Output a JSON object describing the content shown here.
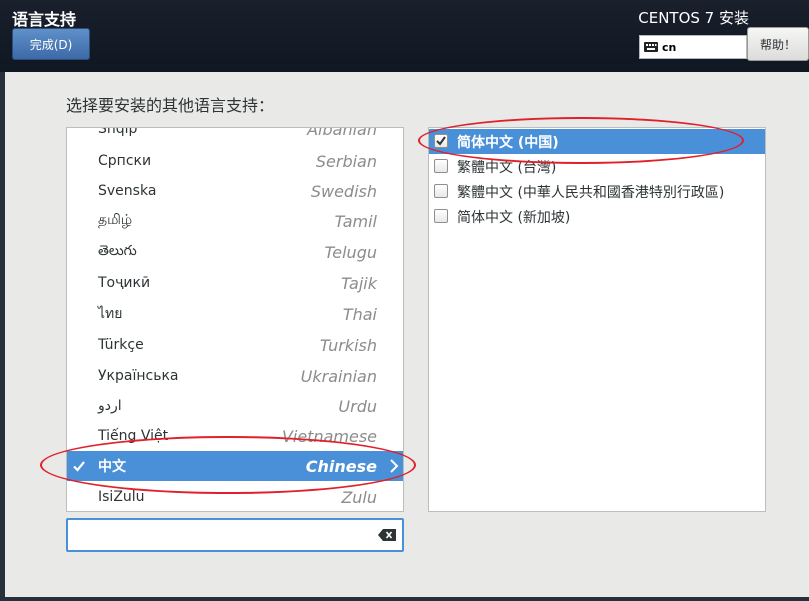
{
  "header": {
    "screen_title": "语言支持",
    "done_label": "完成(D)",
    "product_title": "CENTOS 7 安装",
    "keyboard_layout": "cn",
    "help_label": "帮助！"
  },
  "prompt": "选择要安装的其他语言支持：",
  "languages": [
    {
      "native": "Shqip",
      "english": "Albanian"
    },
    {
      "native": "Српски",
      "english": "Serbian"
    },
    {
      "native": "Svenska",
      "english": "Swedish"
    },
    {
      "native": "தமிழ்",
      "english": "Tamil"
    },
    {
      "native": "తెలుగు",
      "english": "Telugu"
    },
    {
      "native": "Тоҷикӣ",
      "english": "Tajik"
    },
    {
      "native": "ไทย",
      "english": "Thai"
    },
    {
      "native": "Türkçe",
      "english": "Turkish"
    },
    {
      "native": "Українська",
      "english": "Ukrainian"
    },
    {
      "native": "اردو",
      "english": "Urdu"
    },
    {
      "native": "Tiếng Việt",
      "english": "Vietnamese"
    },
    {
      "native": "中文",
      "english": "Chinese",
      "selected": true
    },
    {
      "native": "IsiZulu",
      "english": "Zulu"
    }
  ],
  "search": {
    "value": ""
  },
  "locales": [
    {
      "label": "简体中文 (中国)",
      "checked": true,
      "selected": true
    },
    {
      "label": "繁體中文 (台灣)",
      "checked": false
    },
    {
      "label": "繁體中文 (中華人民共和國香港特別行政區)",
      "checked": false
    },
    {
      "label": "简体中文 (新加坡)",
      "checked": false
    }
  ],
  "colors": {
    "selection": "#4a90d9",
    "annotation": "#e0202a",
    "header_bg": "#19202c"
  },
  "icons": {
    "keyboard": "keyboard-icon",
    "check": "check-icon",
    "arrow": "chevron-right-icon",
    "clear": "clear-search-icon"
  }
}
